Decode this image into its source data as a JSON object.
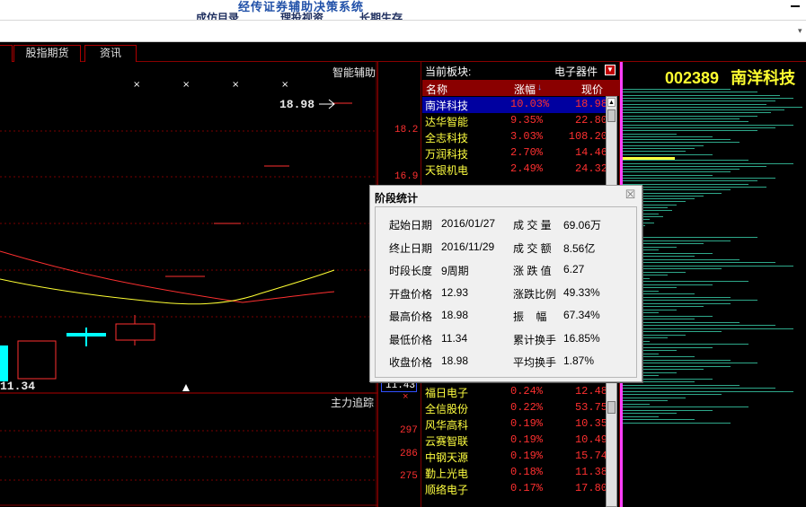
{
  "window": {
    "title": "经传证券辅助决策系统",
    "menu_fragments": [
      "成仿目录",
      "理投视资",
      "长期生存"
    ]
  },
  "tabs": [
    "股指期货",
    "资讯"
  ],
  "chart": {
    "indicator_label": "智能辅助",
    "price_high_label": "18.98",
    "price_low_label": "11.34",
    "sub_label": "主力追踪",
    "scale_upper": [
      "18.2",
      "16.9"
    ],
    "scale_low_box": "11.43",
    "scale_lower": [
      "297",
      "286",
      "275"
    ],
    "colors": {
      "up": "#ff3030",
      "down": "#00ffff",
      "ma": "#ffff33",
      "ma2": "#ff3030"
    }
  },
  "sector": {
    "label": "当前板块:",
    "value": "电子器件",
    "col_name": "名称",
    "col_pct": "涨幅",
    "col_price": "现价",
    "rows_top": [
      {
        "name": "南洋科技",
        "pct": "10.03%",
        "price": "18.98"
      },
      {
        "name": "达华智能",
        "pct": "9.35%",
        "price": "22.80"
      },
      {
        "name": "全志科技",
        "pct": "3.03%",
        "price": "108.20"
      },
      {
        "name": "万润科技",
        "pct": "2.70%",
        "price": "14.46"
      },
      {
        "name": "天银机电",
        "pct": "2.49%",
        "price": "24.32"
      }
    ],
    "rows_bottom": [
      {
        "name": "福日电子",
        "pct": "0.24%",
        "price": "12.48"
      },
      {
        "name": "全信股份",
        "pct": "0.22%",
        "price": "53.75"
      },
      {
        "name": "风华高科",
        "pct": "0.19%",
        "price": "10.35"
      },
      {
        "name": "云赛智联",
        "pct": "0.19%",
        "price": "10.49"
      },
      {
        "name": "中钢天源",
        "pct": "0.19%",
        "price": "15.74"
      },
      {
        "name": "勤上光电",
        "pct": "0.18%",
        "price": "11.38"
      },
      {
        "name": "顺络电子",
        "pct": "0.17%",
        "price": "17.80"
      }
    ]
  },
  "stock": {
    "code": "002389",
    "name": "南洋科技"
  },
  "dialog": {
    "title": "阶段统计",
    "close": "☒",
    "left": [
      {
        "label": "起始日期",
        "value": "2016/01/27"
      },
      {
        "label": "终止日期",
        "value": "2016/11/29"
      },
      {
        "label": "时段长度",
        "value": "9周期"
      },
      {
        "label": "开盘价格",
        "value": "12.93"
      },
      {
        "label": "最高价格",
        "value": "18.98"
      },
      {
        "label": "最低价格",
        "value": "11.34"
      },
      {
        "label": "收盘价格",
        "value": "18.98"
      }
    ],
    "right": [
      {
        "label": "成 交 量",
        "value": "69.06万"
      },
      {
        "label": "成 交 额",
        "value": "8.56亿"
      },
      {
        "label": "涨 跌 值",
        "value": "6.27"
      },
      {
        "label": "涨跌比例",
        "value": "49.33%"
      },
      {
        "label": "振    幅",
        "value": "67.34%"
      },
      {
        "label": "累计换手",
        "value": "16.85%"
      },
      {
        "label": "平均换手",
        "value": "1.87%"
      }
    ]
  }
}
